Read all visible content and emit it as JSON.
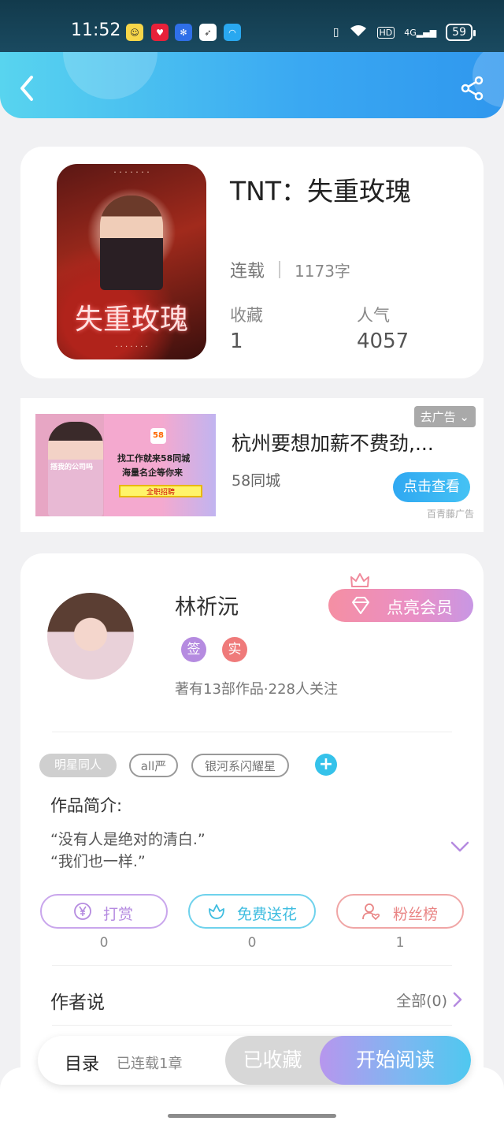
{
  "status_bar": {
    "time": "11:52",
    "network": "4G",
    "hd": "HD",
    "battery": "59",
    "notification_icons": [
      "wechat-icon",
      "pinduoduo-icon",
      "baidu-icon",
      "pigeon-icon",
      "browser-icon"
    ]
  },
  "header": {
    "back_icon": "back-chevron-icon",
    "share_icon": "share-icon",
    "accent_colors": [
      "#58d4ef",
      "#2f97ee"
    ]
  },
  "book": {
    "title": "TNT：失重玫瑰",
    "status": "连载",
    "word_count": "1173字",
    "favorites_label": "收藏",
    "favorites_value": "1",
    "popularity_label": "人气",
    "popularity_value": "4057",
    "cover": {
      "title_text": "失重玫瑰",
      "tag_text": "<TNT>"
    }
  },
  "ad": {
    "close_label": "去广告",
    "title": "杭州要想加薪不费劲,...",
    "source": "58同城",
    "cta": "点击查看",
    "brand": "百青藤广告",
    "image": {
      "logo": "58",
      "line1": "找工作就来58同城",
      "line2": "海量名企等你来",
      "bar": "全职招聘",
      "side": "搭我的公司吗"
    }
  },
  "author": {
    "name": "林祈沅",
    "badge_sign": "签",
    "badge_real": "实",
    "description": "著有13部作品·228人关注",
    "vip_label": "点亮会员"
  },
  "tags": [
    "明星同人",
    "all严",
    "银河系闪耀星"
  ],
  "intro": {
    "label": "作品简介:",
    "lines": [
      "“没有人是绝对的清白.”",
      "“我们也一样.”"
    ]
  },
  "actions": [
    {
      "label": "打赏",
      "count": "0",
      "icon": "yen-coin-icon",
      "color": "#b58be0"
    },
    {
      "label": "免费送花",
      "count": "0",
      "icon": "flower-icon",
      "color": "#4cc6e6"
    },
    {
      "label": "粉丝榜",
      "count": "1",
      "icon": "fan-user-icon",
      "color": "#ee8f8f"
    }
  ],
  "author_says": {
    "title": "作者说",
    "more": "全部(0)"
  },
  "bottom_bar": {
    "toc": "目录",
    "toc_sub": "已连载1章",
    "favorited": "已收藏",
    "start_reading": "开始阅读"
  }
}
